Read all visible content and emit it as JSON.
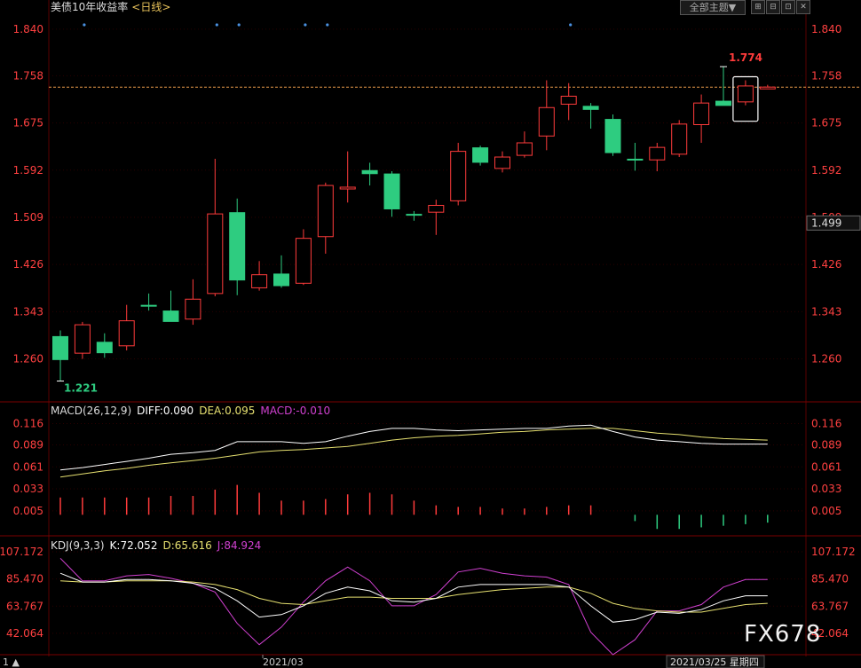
{
  "header": {
    "title": "美债10年收益率",
    "period": "<日线>",
    "theme_button": "全部主题▼",
    "window_buttons": [
      "⊞",
      "⊟",
      "⊡",
      "✕"
    ]
  },
  "colors": {
    "up": "#ff3b3b",
    "down": "#2ecc80",
    "axis_text": "#ff4040",
    "grid": "#3a0000",
    "white": "#ffffff",
    "yellow": "#e6e070",
    "magenta": "#d040d0",
    "dashed_line": "#e89a4a"
  },
  "chart_data": [
    {
      "type": "candlestick",
      "title": "美债10年收益率",
      "y_ticks": [
        "1.840",
        "1.758",
        "1.675",
        "1.592",
        "1.509",
        "1.426",
        "1.343",
        "1.260"
      ],
      "ylim": [
        1.2,
        1.86
      ],
      "high_label": "1.774",
      "low_label": "1.221",
      "current_price_label": "1.499",
      "reference_line": 1.738,
      "candles": [
        {
          "o": 1.3,
          "h": 1.31,
          "l": 1.221,
          "c": 1.258
        },
        {
          "o": 1.27,
          "h": 1.325,
          "l": 1.26,
          "c": 1.32
        },
        {
          "o": 1.29,
          "h": 1.305,
          "l": 1.262,
          "c": 1.27
        },
        {
          "o": 1.283,
          "h": 1.355,
          "l": 1.275,
          "c": 1.327
        },
        {
          "o": 1.355,
          "h": 1.375,
          "l": 1.345,
          "c": 1.352
        },
        {
          "o": 1.345,
          "h": 1.38,
          "l": 1.34,
          "c": 1.325
        },
        {
          "o": 1.33,
          "h": 1.4,
          "l": 1.32,
          "c": 1.365
        },
        {
          "o": 1.375,
          "h": 1.612,
          "l": 1.37,
          "c": 1.515
        },
        {
          "o": 1.518,
          "h": 1.542,
          "l": 1.372,
          "c": 1.398
        },
        {
          "o": 1.385,
          "h": 1.432,
          "l": 1.38,
          "c": 1.408
        },
        {
          "o": 1.41,
          "h": 1.442,
          "l": 1.385,
          "c": 1.388
        },
        {
          "o": 1.393,
          "h": 1.488,
          "l": 1.39,
          "c": 1.472
        },
        {
          "o": 1.475,
          "h": 1.57,
          "l": 1.445,
          "c": 1.565
        },
        {
          "o": 1.562,
          "h": 1.625,
          "l": 1.535,
          "c": 1.562
        },
        {
          "o": 1.592,
          "h": 1.605,
          "l": 1.565,
          "c": 1.585
        },
        {
          "o": 1.586,
          "h": 1.59,
          "l": 1.51,
          "c": 1.523
        },
        {
          "o": 1.515,
          "h": 1.52,
          "l": 1.503,
          "c": 1.512
        },
        {
          "o": 1.518,
          "h": 1.54,
          "l": 1.478,
          "c": 1.53
        },
        {
          "o": 1.538,
          "h": 1.64,
          "l": 1.53,
          "c": 1.625
        },
        {
          "o": 1.632,
          "h": 1.635,
          "l": 1.6,
          "c": 1.605
        },
        {
          "o": 1.595,
          "h": 1.625,
          "l": 1.588,
          "c": 1.615
        },
        {
          "o": 1.618,
          "h": 1.66,
          "l": 1.614,
          "c": 1.64
        },
        {
          "o": 1.652,
          "h": 1.75,
          "l": 1.627,
          "c": 1.702
        },
        {
          "o": 1.708,
          "h": 1.745,
          "l": 1.68,
          "c": 1.722
        },
        {
          "o": 1.705,
          "h": 1.71,
          "l": 1.665,
          "c": 1.698
        },
        {
          "o": 1.682,
          "h": 1.69,
          "l": 1.617,
          "c": 1.622
        },
        {
          "o": 1.612,
          "h": 1.64,
          "l": 1.591,
          "c": 1.61
        },
        {
          "o": 1.61,
          "h": 1.64,
          "l": 1.59,
          "c": 1.632
        },
        {
          "o": 1.62,
          "h": 1.68,
          "l": 1.615,
          "c": 1.673
        },
        {
          "o": 1.672,
          "h": 1.725,
          "l": 1.64,
          "c": 1.71
        },
        {
          "o": 1.714,
          "h": 1.774,
          "l": 1.706,
          "c": 1.705
        },
        {
          "o": 1.712,
          "h": 1.75,
          "l": 1.706,
          "c": 1.74
        },
        {
          "o": 1.738,
          "h": 1.742,
          "l": 1.735,
          "c": 1.738
        }
      ],
      "highlight_index": 31,
      "marker_indices": [
        1,
        7,
        8,
        11,
        12,
        23
      ]
    },
    {
      "type": "macd",
      "label": "MACD(26,12,9)",
      "diff_label": "DIFF:0.090",
      "dea_label": "DEA:0.095",
      "macd_label": "MACD:-0.010",
      "y_ticks": [
        "0.116",
        "0.089",
        "0.061",
        "0.033",
        "0.005"
      ],
      "ylim": [
        -0.02,
        0.12
      ],
      "diff": [
        0.057,
        0.06,
        0.064,
        0.068,
        0.072,
        0.077,
        0.079,
        0.082,
        0.093,
        0.093,
        0.093,
        0.091,
        0.093,
        0.1,
        0.106,
        0.11,
        0.11,
        0.108,
        0.107,
        0.108,
        0.109,
        0.11,
        0.11,
        0.113,
        0.114,
        0.106,
        0.099,
        0.095,
        0.093,
        0.091,
        0.09,
        0.09,
        0.09
      ],
      "dea": [
        0.048,
        0.052,
        0.056,
        0.059,
        0.063,
        0.066,
        0.069,
        0.072,
        0.076,
        0.08,
        0.082,
        0.083,
        0.085,
        0.087,
        0.091,
        0.095,
        0.098,
        0.1,
        0.101,
        0.103,
        0.105,
        0.106,
        0.108,
        0.109,
        0.11,
        0.11,
        0.107,
        0.104,
        0.102,
        0.099,
        0.097,
        0.096,
        0.095
      ],
      "macd": [
        0.022,
        0.022,
        0.022,
        0.022,
        0.022,
        0.024,
        0.024,
        0.032,
        0.038,
        0.028,
        0.018,
        0.018,
        0.02,
        0.026,
        0.028,
        0.026,
        0.018,
        0.012,
        0.01,
        0.01,
        0.008,
        0.008,
        0.01,
        0.012,
        0.012,
        0.0,
        -0.008,
        -0.018,
        -0.018,
        -0.016,
        -0.014,
        -0.012,
        -0.01
      ]
    },
    {
      "type": "kdj",
      "label": "KDJ(9,3,3)",
      "k_label": "K:72.052",
      "d_label": "D:65.616",
      "j_label": "J:84.924",
      "y_ticks": [
        "107.172",
        "85.470",
        "63.767",
        "42.064"
      ],
      "ylim": [
        25,
        110
      ],
      "k": [
        90,
        83,
        83,
        85,
        85,
        84,
        82,
        78,
        68,
        55,
        57,
        64,
        74,
        79,
        76,
        68,
        67,
        70,
        79,
        81,
        81,
        81,
        81,
        79,
        64,
        51,
        53,
        59,
        58,
        61,
        68,
        72,
        72
      ],
      "d": [
        84,
        83,
        83,
        84,
        84,
        84,
        83,
        81,
        77,
        70,
        66,
        65,
        68,
        71,
        71,
        70,
        70,
        70,
        73,
        75,
        77,
        78,
        79,
        79,
        74,
        66,
        62,
        60,
        59,
        59,
        62,
        65,
        66
      ],
      "j": [
        102,
        84,
        84,
        88,
        89,
        86,
        82,
        75,
        50,
        33,
        47,
        67,
        84,
        95,
        84,
        64,
        64,
        73,
        91,
        94,
        90,
        88,
        87,
        81,
        43,
        25,
        37,
        60,
        60,
        65,
        79,
        85,
        85
      ]
    }
  ],
  "x_axis": {
    "labels": [
      "2021/03",
      "2021/03/25 星期四"
    ],
    "left_marker": "1 ▲"
  },
  "watermark": "FX678"
}
